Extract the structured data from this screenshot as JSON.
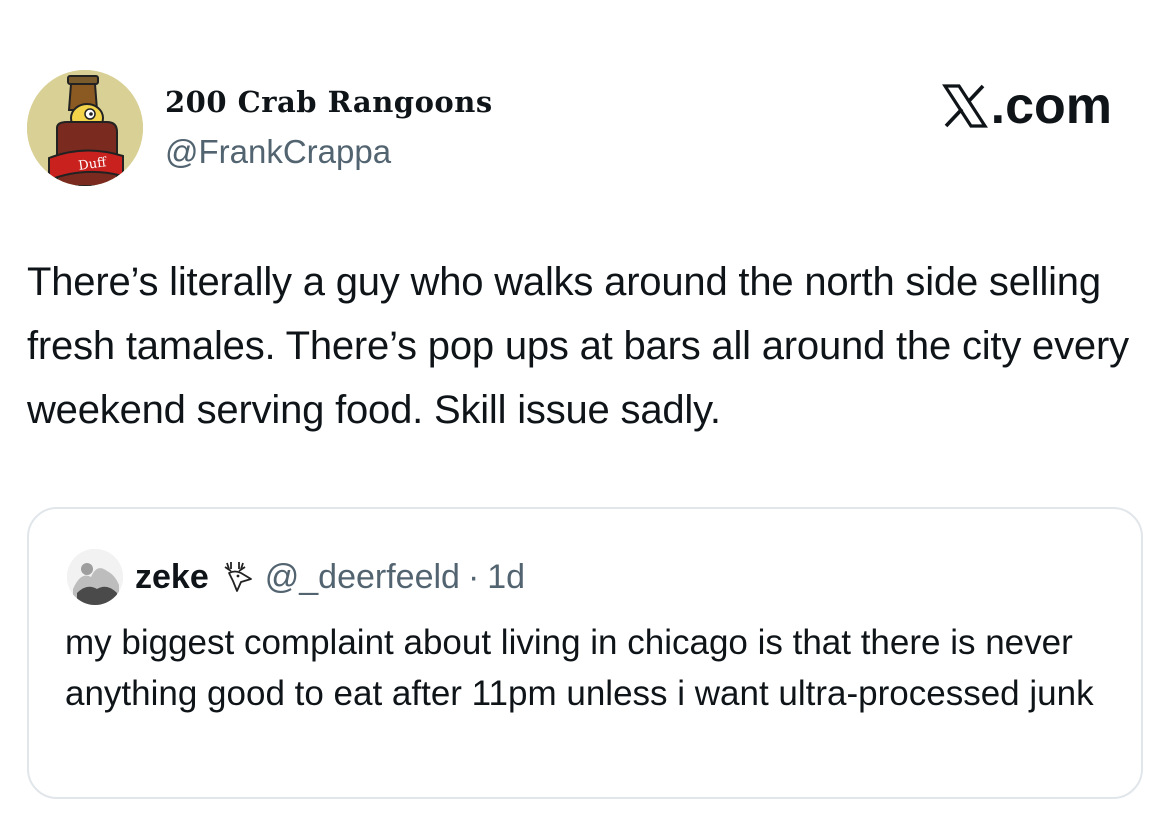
{
  "author": {
    "display_name": "200 Crab Rangoons",
    "handle": "@FrankCrappa",
    "avatar_icon": "duff-beer-bottle-avatar",
    "avatar_label": "Duff"
  },
  "brand": {
    "text": ".com",
    "icon": "x-logo-icon"
  },
  "tweet": {
    "text": "There’s literally a guy who walks around the north side selling fresh tamales. There’s pop ups at bars all around the city every weekend serving food. Skill issue sadly."
  },
  "quoted_tweet": {
    "display_name": "zeke",
    "name_emoji_icon": "deer-icon",
    "handle": "@_deerfeeld",
    "separator": "·",
    "time": "1d",
    "text": "my biggest complaint about living in chicago is that there is never anything good to eat after 11pm unless i want ultra-processed junk"
  },
  "colors": {
    "text_primary": "#0f1419",
    "text_secondary": "#536471",
    "card_border": "#e1e6ea"
  }
}
